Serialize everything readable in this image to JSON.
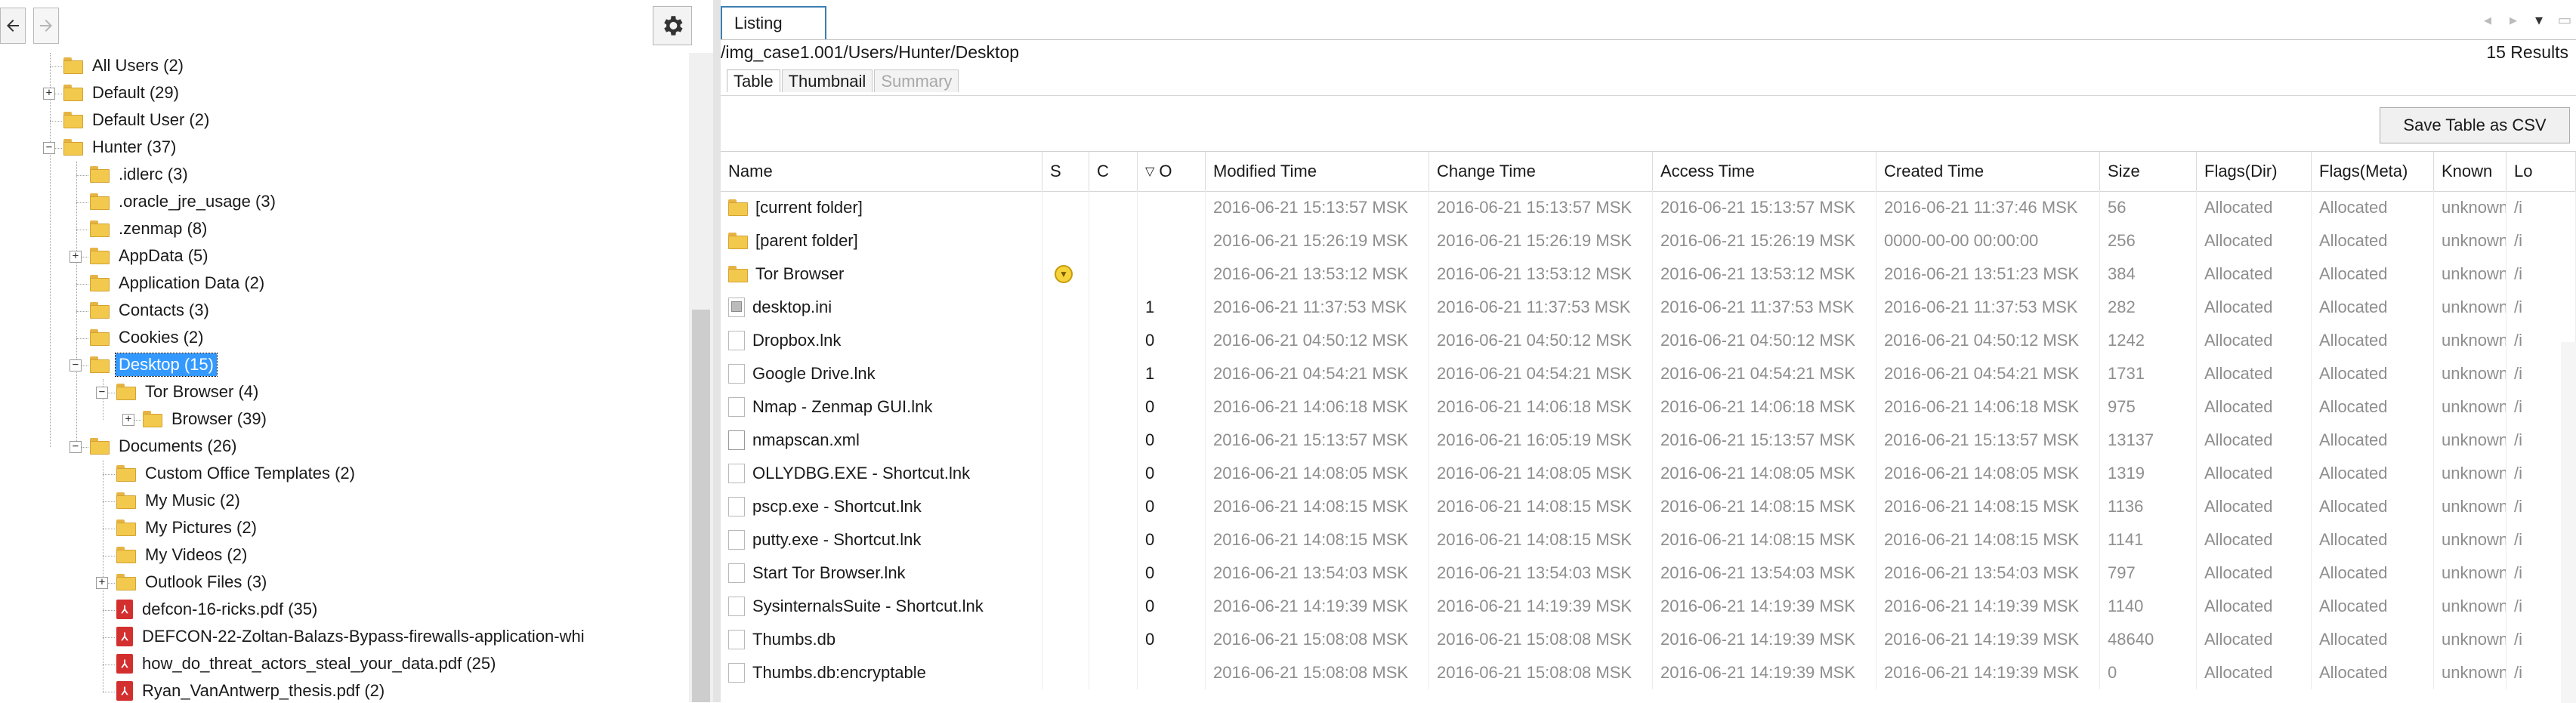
{
  "toolbar": {
    "back_icon": "arrow-left-icon",
    "forward_icon": "arrow-right-icon",
    "settings_icon": "gear-icon"
  },
  "tree": {
    "nodes": [
      {
        "label": "All Users (2)",
        "icon": "folder-icon",
        "expander": ""
      },
      {
        "label": "Default (29)",
        "icon": "folder-icon",
        "expander": "+"
      },
      {
        "label": "Default User (2)",
        "icon": "folder-icon",
        "expander": ""
      },
      {
        "label": "Hunter (37)",
        "icon": "folder-icon",
        "expander": "−"
      },
      {
        "label": ".idlerc (3)",
        "icon": "folder-icon",
        "expander": ""
      },
      {
        "label": ".oracle_jre_usage (3)",
        "icon": "folder-icon",
        "expander": ""
      },
      {
        "label": ".zenmap (8)",
        "icon": "folder-icon",
        "expander": ""
      },
      {
        "label": "AppData (5)",
        "icon": "folder-icon",
        "expander": "+"
      },
      {
        "label": "Application Data (2)",
        "icon": "folder-icon",
        "expander": ""
      },
      {
        "label": "Contacts (3)",
        "icon": "folder-icon",
        "expander": ""
      },
      {
        "label": "Cookies (2)",
        "icon": "folder-icon",
        "expander": ""
      },
      {
        "label": "Desktop (15)",
        "icon": "folder-icon",
        "expander": "−",
        "selected": true
      },
      {
        "label": "Tor Browser (4)",
        "icon": "folder-icon",
        "expander": "−"
      },
      {
        "label": "Browser (39)",
        "icon": "folder-icon",
        "expander": "+"
      },
      {
        "label": "Documents (26)",
        "icon": "folder-icon",
        "expander": "−"
      },
      {
        "label": "Custom Office Templates (2)",
        "icon": "folder-icon",
        "expander": ""
      },
      {
        "label": "My Music (2)",
        "icon": "folder-icon",
        "expander": ""
      },
      {
        "label": "My Pictures (2)",
        "icon": "folder-icon",
        "expander": ""
      },
      {
        "label": "My Videos (2)",
        "icon": "folder-icon",
        "expander": ""
      },
      {
        "label": "Outlook Files (3)",
        "icon": "folder-icon",
        "expander": "+"
      },
      {
        "label": "defcon-16-ricks.pdf (35)",
        "icon": "pdf-icon",
        "expander": ""
      },
      {
        "label": "DEFCON-22-Zoltan-Balazs-Bypass-firewalls-application-whi",
        "icon": "pdf-icon",
        "expander": ""
      },
      {
        "label": "how_do_threat_actors_steal_your_data.pdf (25)",
        "icon": "pdf-icon",
        "expander": ""
      },
      {
        "label": "Ryan_VanAntwerp_thesis.pdf (2)",
        "icon": "pdf-icon",
        "expander": ""
      }
    ]
  },
  "listing": {
    "tab_label": "Listing",
    "path": "/img_case1.001/Users/Hunter/Desktop",
    "results": "15  Results",
    "view_tabs": [
      "Table",
      "Thumbnail",
      "Summary"
    ],
    "save_csv_label": "Save Table as CSV",
    "columns": [
      "Name",
      "S",
      "C",
      "O",
      "Modified Time",
      "Change Time",
      "Access Time",
      "Created Time",
      "Size",
      "Flags(Dir)",
      "Flags(Meta)",
      "Known",
      "Lo"
    ],
    "sort_icon": "sort-down-icon",
    "rows": [
      {
        "name": "[current folder]",
        "icon": "folder-icon",
        "s": "",
        "c": "",
        "o": "",
        "mtime": "2016-06-21 15:13:57 MSK",
        "ctime": "2016-06-21 15:13:57 MSK",
        "atime": "2016-06-21 15:13:57 MSK",
        "crtime": "2016-06-21 11:37:46 MSK",
        "size": "56",
        "flags_dir": "Allocated",
        "flags_meta": "Allocated",
        "known": "unknown",
        "loc": "/i"
      },
      {
        "name": "[parent folder]",
        "icon": "folder-icon",
        "s": "",
        "c": "",
        "o": "",
        "mtime": "2016-06-21 15:26:19 MSK",
        "ctime": "2016-06-21 15:26:19 MSK",
        "atime": "2016-06-21 15:26:19 MSK",
        "crtime": "0000-00-00 00:00:00",
        "size": "256",
        "flags_dir": "Allocated",
        "flags_meta": "Allocated",
        "known": "unknown",
        "loc": "/i"
      },
      {
        "name": "Tor Browser",
        "icon": "folder-icon",
        "s": "score",
        "c": "",
        "o": "",
        "mtime": "2016-06-21 13:53:12 MSK",
        "ctime": "2016-06-21 13:53:12 MSK",
        "atime": "2016-06-21 13:53:12 MSK",
        "crtime": "2016-06-21 13:51:23 MSK",
        "size": "384",
        "flags_dir": "Allocated",
        "flags_meta": "Allocated",
        "known": "unknown",
        "loc": "/i"
      },
      {
        "name": "desktop.ini",
        "icon": "ini-file-icon",
        "s": "",
        "c": "",
        "o": "1",
        "mtime": "2016-06-21 11:37:53 MSK",
        "ctime": "2016-06-21 11:37:53 MSK",
        "atime": "2016-06-21 11:37:53 MSK",
        "crtime": "2016-06-21 11:37:53 MSK",
        "size": "282",
        "flags_dir": "Allocated",
        "flags_meta": "Allocated",
        "known": "unknown",
        "loc": "/i"
      },
      {
        "name": "Dropbox.lnk",
        "icon": "file-icon",
        "s": "",
        "c": "",
        "o": "0",
        "mtime": "2016-06-21 04:50:12 MSK",
        "ctime": "2016-06-21 04:50:12 MSK",
        "atime": "2016-06-21 04:50:12 MSK",
        "crtime": "2016-06-21 04:50:12 MSK",
        "size": "1242",
        "flags_dir": "Allocated",
        "flags_meta": "Allocated",
        "known": "unknown",
        "loc": "/i"
      },
      {
        "name": "Google Drive.lnk",
        "icon": "file-icon",
        "s": "",
        "c": "",
        "o": "1",
        "mtime": "2016-06-21 04:54:21 MSK",
        "ctime": "2016-06-21 04:54:21 MSK",
        "atime": "2016-06-21 04:54:21 MSK",
        "crtime": "2016-06-21 04:54:21 MSK",
        "size": "1731",
        "flags_dir": "Allocated",
        "flags_meta": "Allocated",
        "known": "unknown",
        "loc": "/i"
      },
      {
        "name": "Nmap - Zenmap GUI.lnk",
        "icon": "file-icon",
        "s": "",
        "c": "",
        "o": "0",
        "mtime": "2016-06-21 14:06:18 MSK",
        "ctime": "2016-06-21 14:06:18 MSK",
        "atime": "2016-06-21 14:06:18 MSK",
        "crtime": "2016-06-21 14:06:18 MSK",
        "size": "975",
        "flags_dir": "Allocated",
        "flags_meta": "Allocated",
        "known": "unknown",
        "loc": "/i"
      },
      {
        "name": "nmapscan.xml",
        "icon": "xml-file-icon",
        "s": "",
        "c": "",
        "o": "0",
        "mtime": "2016-06-21 15:13:57 MSK",
        "ctime": "2016-06-21 16:05:19 MSK",
        "atime": "2016-06-21 15:13:57 MSK",
        "crtime": "2016-06-21 15:13:57 MSK",
        "size": "13137",
        "flags_dir": "Allocated",
        "flags_meta": "Allocated",
        "known": "unknown",
        "loc": "/i"
      },
      {
        "name": "OLLYDBG.EXE - Shortcut.lnk",
        "icon": "file-icon",
        "s": "",
        "c": "",
        "o": "0",
        "mtime": "2016-06-21 14:08:05 MSK",
        "ctime": "2016-06-21 14:08:05 MSK",
        "atime": "2016-06-21 14:08:05 MSK",
        "crtime": "2016-06-21 14:08:05 MSK",
        "size": "1319",
        "flags_dir": "Allocated",
        "flags_meta": "Allocated",
        "known": "unknown",
        "loc": "/i"
      },
      {
        "name": "pscp.exe - Shortcut.lnk",
        "icon": "file-icon",
        "s": "",
        "c": "",
        "o": "0",
        "mtime": "2016-06-21 14:08:15 MSK",
        "ctime": "2016-06-21 14:08:15 MSK",
        "atime": "2016-06-21 14:08:15 MSK",
        "crtime": "2016-06-21 14:08:15 MSK",
        "size": "1136",
        "flags_dir": "Allocated",
        "flags_meta": "Allocated",
        "known": "unknown",
        "loc": "/i"
      },
      {
        "name": "putty.exe - Shortcut.lnk",
        "icon": "file-icon",
        "s": "",
        "c": "",
        "o": "0",
        "mtime": "2016-06-21 14:08:15 MSK",
        "ctime": "2016-06-21 14:08:15 MSK",
        "atime": "2016-06-21 14:08:15 MSK",
        "crtime": "2016-06-21 14:08:15 MSK",
        "size": "1141",
        "flags_dir": "Allocated",
        "flags_meta": "Allocated",
        "known": "unknown",
        "loc": "/i"
      },
      {
        "name": "Start Tor Browser.lnk",
        "icon": "file-icon",
        "s": "",
        "c": "",
        "o": "0",
        "mtime": "2016-06-21 13:54:03 MSK",
        "ctime": "2016-06-21 13:54:03 MSK",
        "atime": "2016-06-21 13:54:03 MSK",
        "crtime": "2016-06-21 13:54:03 MSK",
        "size": "797",
        "flags_dir": "Allocated",
        "flags_meta": "Allocated",
        "known": "unknown",
        "loc": "/i"
      },
      {
        "name": "SysinternalsSuite - Shortcut.lnk",
        "icon": "file-icon",
        "s": "",
        "c": "",
        "o": "0",
        "mtime": "2016-06-21 14:19:39 MSK",
        "ctime": "2016-06-21 14:19:39 MSK",
        "atime": "2016-06-21 14:19:39 MSK",
        "crtime": "2016-06-21 14:19:39 MSK",
        "size": "1140",
        "flags_dir": "Allocated",
        "flags_meta": "Allocated",
        "known": "unknown",
        "loc": "/i"
      },
      {
        "name": "Thumbs.db",
        "icon": "file-icon",
        "s": "",
        "c": "",
        "o": "0",
        "mtime": "2016-06-21 15:08:08 MSK",
        "ctime": "2016-06-21 15:08:08 MSK",
        "atime": "2016-06-21 14:19:39 MSK",
        "crtime": "2016-06-21 14:19:39 MSK",
        "size": "48640",
        "flags_dir": "Allocated",
        "flags_meta": "Allocated",
        "known": "unknown",
        "loc": "/i"
      },
      {
        "name": "Thumbs.db:encryptable",
        "icon": "file-icon",
        "s": "",
        "c": "",
        "o": "",
        "mtime": "2016-06-21 15:08:08 MSK",
        "ctime": "2016-06-21 15:08:08 MSK",
        "atime": "2016-06-21 14:19:39 MSK",
        "crtime": "2016-06-21 14:19:39 MSK",
        "size": "0",
        "flags_dir": "Allocated",
        "flags_meta": "Allocated",
        "known": "unknown",
        "loc": "/i"
      }
    ]
  }
}
